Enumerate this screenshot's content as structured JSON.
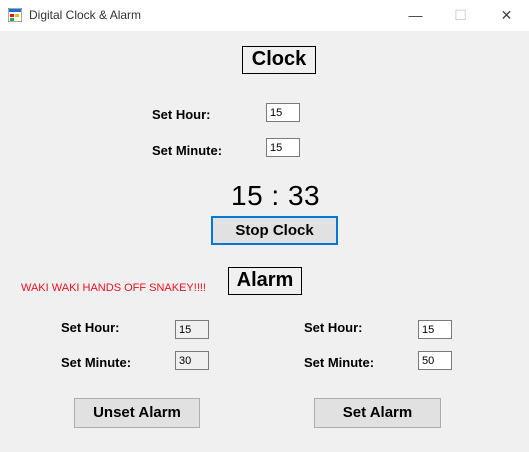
{
  "window": {
    "title": "Digital Clock & Alarm",
    "minimize_glyph": "—",
    "maximize_glyph": "☐",
    "close_glyph": "✕",
    "icon": "app-window-icon"
  },
  "clock": {
    "heading": "Clock",
    "set_hour_label": "Set Hour:",
    "set_hour_value": "15",
    "set_minute_label": "Set Minute:",
    "set_minute_value": "15",
    "time_display": "15 : 33",
    "stop_button": "Stop Clock"
  },
  "alarm": {
    "heading": "Alarm",
    "message": "WAKI WAKI HANDS OFF SNAKEY!!!!",
    "current": {
      "set_hour_label": "Set Hour:",
      "set_hour_value": "15",
      "set_minute_label": "Set Minute:",
      "set_minute_value": "30"
    },
    "new": {
      "set_hour_label": "Set Hour:",
      "set_hour_value": "15",
      "set_minute_label": "Set Minute:",
      "set_minute_value": "50"
    },
    "unset_button": "Unset Alarm",
    "set_button": "Set Alarm"
  },
  "colors": {
    "message": "#e81123",
    "focus_border": "#0078d7"
  }
}
